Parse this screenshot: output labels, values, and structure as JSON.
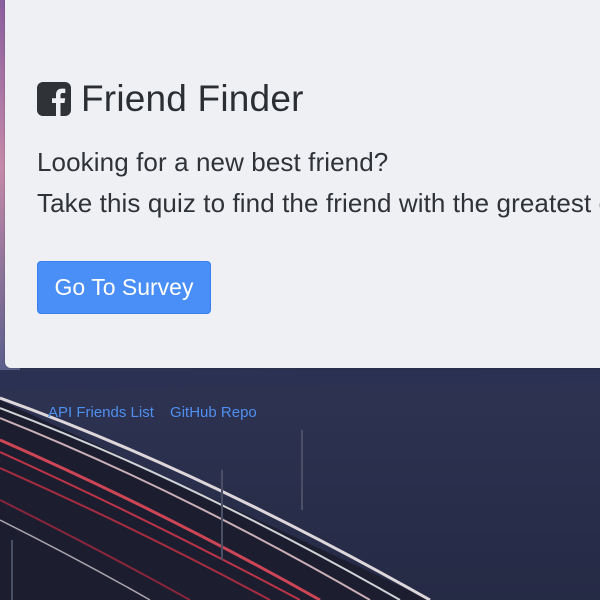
{
  "brand": {
    "icon": "facebook-icon",
    "title": "Friend Finder",
    "accent": "#4a8ff7"
  },
  "intro": {
    "line1": "Looking for a new best friend?",
    "line2": "Take this quiz to find the friend with the greatest compatibility!"
  },
  "actions": {
    "survey_label": "Go To Survey"
  },
  "footer": {
    "links": [
      {
        "label": "API Friends List"
      },
      {
        "label": "GitHub Repo"
      }
    ],
    "link_color": "#4f8ff0"
  }
}
